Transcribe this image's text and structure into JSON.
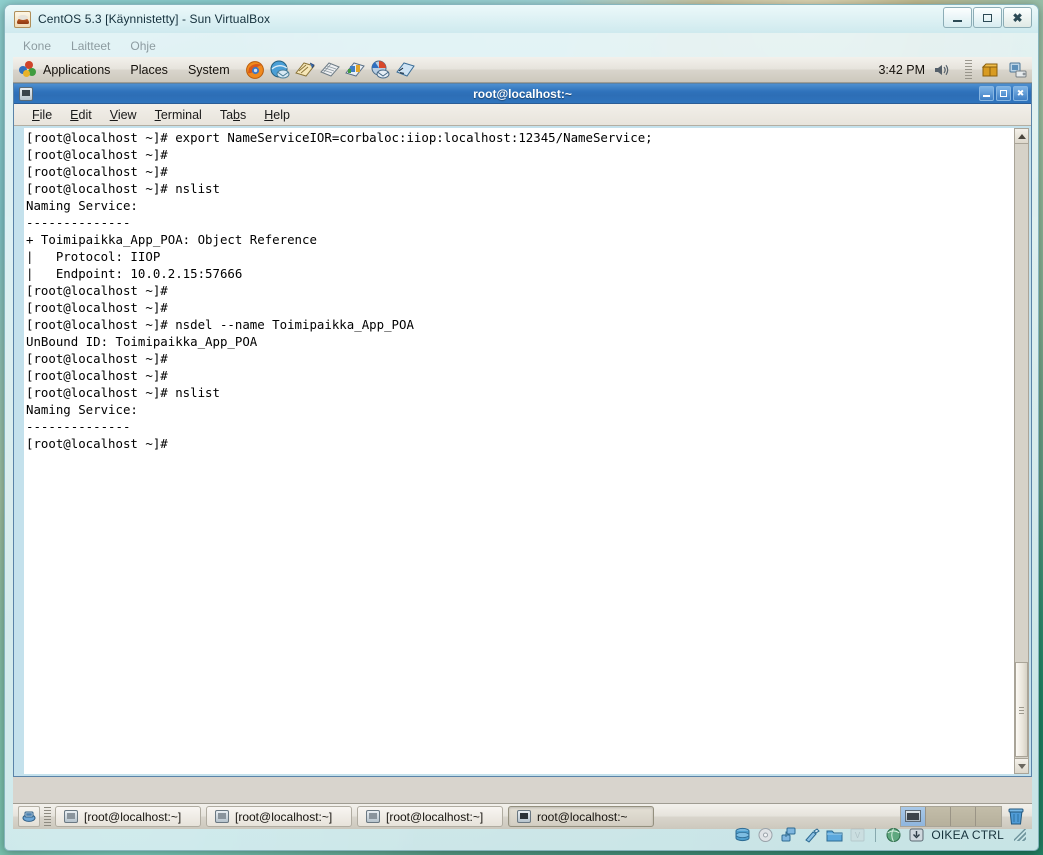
{
  "vbox_window": {
    "title": "CentOS 5.3 [Käynnistetty] - Sun VirtualBox",
    "app_icon": "centos-icon",
    "menus": [
      {
        "label": "Kone",
        "name": "vbox-menu-machine"
      },
      {
        "label": "Laitteet",
        "name": "vbox-menu-devices"
      },
      {
        "label": "Ohje",
        "name": "vbox-menu-help"
      }
    ],
    "window_buttons": {
      "minimize": "minimize-icon",
      "maximize": "maximize-icon",
      "close": "close-icon"
    }
  },
  "gnome_top_panel": {
    "menus": [
      {
        "label": "Applications",
        "name": "panel-menu-applications"
      },
      {
        "label": "Places",
        "name": "panel-menu-places"
      },
      {
        "label": "System",
        "name": "panel-menu-system"
      }
    ],
    "launchers": [
      {
        "name": "firefox-launcher-icon"
      },
      {
        "name": "evolution-launcher-icon"
      },
      {
        "name": "openoffice-writer-launcher-icon"
      },
      {
        "name": "openoffice-calc-launcher-icon"
      },
      {
        "name": "openoffice-impress-launcher-icon"
      },
      {
        "name": "help-launcher-icon"
      },
      {
        "name": "terminal-launcher-icon"
      }
    ],
    "clock": "3:42 PM",
    "volume_icon": "volume-icon",
    "tray_icons": [
      {
        "name": "package-updater-icon"
      },
      {
        "name": "network-manager-icon"
      }
    ]
  },
  "terminal": {
    "title": "root@localhost:~",
    "window_icon": "terminal-window-icon",
    "window_buttons": {
      "minimize": "minimize-icon",
      "maximize": "maximize-icon",
      "close": "close-icon"
    },
    "menus": [
      {
        "label": "File",
        "mnemonic": "F",
        "name": "terminal-menu-file"
      },
      {
        "label": "Edit",
        "mnemonic": "E",
        "name": "terminal-menu-edit"
      },
      {
        "label": "View",
        "mnemonic": "V",
        "name": "terminal-menu-view"
      },
      {
        "label": "Terminal",
        "mnemonic": "T",
        "name": "terminal-menu-terminal"
      },
      {
        "label": "Tabs",
        "mnemonic": "b",
        "name": "terminal-menu-tabs"
      },
      {
        "label": "Help",
        "mnemonic": "H",
        "name": "terminal-menu-help"
      }
    ],
    "content": "[root@localhost ~]# export NameServiceIOR=corbaloc:iiop:localhost:12345/NameService;\n[root@localhost ~]#\n[root@localhost ~]#\n[root@localhost ~]# nslist\nNaming Service:\n--------------\n+ Toimipaikka_App_POA: Object Reference\n|   Protocol: IIOP\n|   Endpoint: 10.0.2.15:57666\n[root@localhost ~]#\n[root@localhost ~]#\n[root@localhost ~]# nsdel --name Toimipaikka_App_POA\nUnBound ID: Toimipaikka_App_POA\n[root@localhost ~]#\n[root@localhost ~]#\n[root@localhost ~]# nslist\nNaming Service:\n--------------\n[root@localhost ~]#",
    "scrollbar": {
      "up_arrow": "scroll-up-icon",
      "down_arrow": "scroll-down-icon"
    }
  },
  "gnome_bottom_panel": {
    "show_desktop_icon": "show-desktop-icon",
    "tasks": [
      {
        "label": "[root@localhost:~]",
        "active": false
      },
      {
        "label": "[root@localhost:~]",
        "active": false
      },
      {
        "label": "[root@localhost:~]",
        "active": false
      },
      {
        "label": "root@localhost:~",
        "active": true
      }
    ],
    "workspaces": [
      {
        "active": true,
        "has_window": true
      },
      {
        "active": false,
        "has_window": false
      },
      {
        "active": false,
        "has_window": false
      },
      {
        "active": false,
        "has_window": false
      }
    ],
    "trash_icon": "trash-icon"
  },
  "vbox_statusbar": {
    "icons": [
      {
        "name": "hard-disk-icon"
      },
      {
        "name": "cd-dvd-icon"
      },
      {
        "name": "network-icon"
      },
      {
        "name": "usb-icon"
      },
      {
        "name": "shared-folders-icon"
      },
      {
        "name": "vrdp-icon"
      },
      {
        "name": "virtualization-icon"
      },
      {
        "name": "host-key-icon"
      }
    ],
    "host_key_label": "OIKEA CTRL",
    "resize_grip": "resize-grip-icon"
  },
  "colors": {
    "terminal_title_blue": "#2f72bb",
    "terminal_bg": "#ffffff",
    "terminal_fg": "#000000",
    "terminal_border": "#c4e1ec",
    "panel_bg": "#e6e3dc"
  }
}
